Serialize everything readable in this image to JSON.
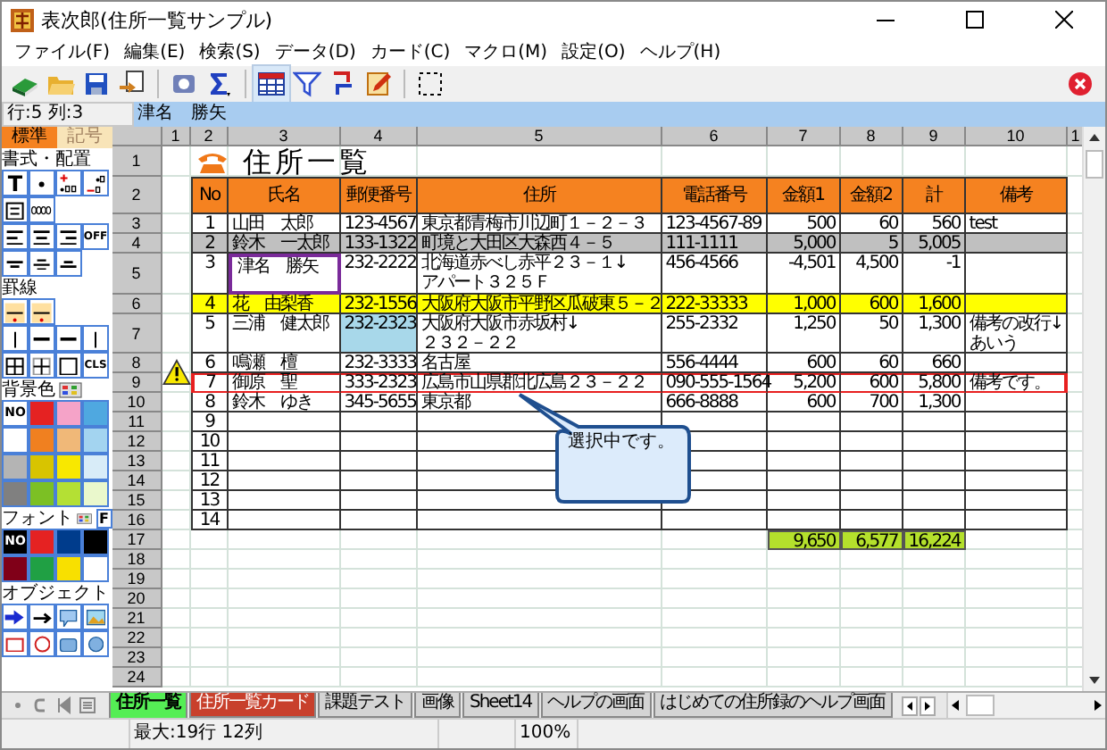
{
  "window": {
    "title": "表次郎(住所一覧サンプル)"
  },
  "menu": [
    "ファイル(F)",
    "編集(E)",
    "検索(S)",
    "データ(D)",
    "カード(C)",
    "マクロ(M)",
    "設定(O)",
    "ヘルプ(H)"
  ],
  "formula_bar": {
    "position": "行:5 列:3",
    "value": "津名　勝矢"
  },
  "palette": {
    "tabs": [
      {
        "label": "標準",
        "selected": true
      },
      {
        "label": "記号",
        "selected": false
      }
    ],
    "sections": [
      {
        "kind": "format",
        "title": "書式・配置",
        "labels": [
          "T",
          "OFF"
        ]
      },
      {
        "kind": "border",
        "title": "罫線",
        "labels": [
          "CLS"
        ]
      },
      {
        "kind": "background",
        "title": "背景色",
        "swatches": [
          {
            "label": "NO",
            "color": "#ffffff"
          },
          {
            "color": "#e52222"
          },
          {
            "color": "#f5a3c8"
          },
          {
            "color": "#4fa8e0"
          },
          {
            "color": "#ffffff"
          },
          {
            "color": "#f08020"
          },
          {
            "color": "#f0b878"
          },
          {
            "color": "#a3d4f0"
          },
          {
            "color": "#b4b4b4"
          },
          {
            "color": "#d8c400"
          },
          {
            "color": "#f8e800"
          },
          {
            "color": "#d8ecf8"
          },
          {
            "color": "#808080"
          },
          {
            "color": "#7cc024"
          },
          {
            "color": "#b4e034"
          },
          {
            "color": "#eaf8cc"
          }
        ]
      },
      {
        "kind": "font",
        "title": "フォント",
        "labels": [
          "F"
        ],
        "swatches": [
          {
            "label": "NO",
            "color": "#000000"
          },
          {
            "color": "#e52222"
          },
          {
            "color": "#003c8c"
          },
          {
            "color": "#000000"
          },
          {
            "color": "#800018"
          },
          {
            "color": "#20a044"
          },
          {
            "color": "#f8e000"
          },
          {
            "color": "#ffffff"
          }
        ]
      },
      {
        "kind": "object",
        "title": "オブジェクト"
      }
    ]
  },
  "sheet": {
    "column_headers": [
      "1",
      "2",
      "3",
      "4",
      "5",
      "6",
      "7",
      "8",
      "9",
      "10",
      "1"
    ],
    "row_headers": [
      "1",
      "2",
      "3",
      "4",
      "5",
      "6",
      "7",
      "8",
      "9",
      "10",
      "11",
      "12",
      "13",
      "14",
      "15",
      "16",
      "17",
      "18",
      "19",
      "20",
      "21",
      "22",
      "23",
      "24"
    ],
    "title": "住所一覧",
    "table": {
      "columns": [
        "No",
        "氏名",
        "郵便番号",
        "住所",
        "電話番号",
        "金額1",
        "金額2",
        "計",
        "備考"
      ],
      "rows": [
        {
          "outlined": false,
          "cells": [
            "1",
            "山田　太郎",
            "123-4567",
            "東京都青梅市川辺町１－２－３",
            "123-4567-89",
            "500",
            "60",
            "560",
            "test"
          ]
        },
        {
          "outlined": false,
          "color": "#c0c0c0",
          "cells": [
            "2",
            "鈴木　一太郎",
            "133-1322",
            "町境と大田区大森西４－５",
            "111-1111",
            "5,000",
            "5",
            "5,005",
            ""
          ]
        },
        {
          "outlined": false,
          "cells": [
            "3",
            {
              "text": "津名　勝矢",
              "selected": true
            },
            "232-2222",
            "北海道赤べし赤平２３－１↓\nアパート３２５Ｆ",
            "456-4566",
            "-4,501",
            "4,500",
            "-1",
            ""
          ]
        },
        {
          "outlined": false,
          "color": "#ffff00",
          "cells": [
            "4",
            "花　由梨香",
            "232-1556",
            "大阪府大阪市平野区瓜破東５－２",
            "222-33333",
            "1,000",
            "600",
            "1,600",
            ""
          ]
        },
        {
          "outlined": false,
          "cells": [
            "5",
            "三浦　健太郎",
            {
              "text": "232-2323",
              "color": "#a8d8ea"
            },
            "大阪府大阪市赤坂村↓\n２３２－２２",
            "255-2332",
            "1,250",
            "50",
            "1,300",
            "備考の改行↓\nあいう"
          ]
        },
        {
          "outlined": false,
          "cells": [
            "6",
            "鳴瀬　檀",
            "232-3333",
            "名古屋",
            "556-4444",
            "600",
            "60",
            "660",
            ""
          ]
        },
        {
          "outlined": true,
          "cells": [
            "7",
            "御原　聖",
            "333-2323",
            "広島市山県郡北広島２３－２２",
            "090-555-1564",
            "5,200",
            "600",
            "5,800",
            "備考です。"
          ]
        },
        {
          "outlined": false,
          "cells": [
            "8",
            "鈴木　ゆき",
            "345-5655",
            "東京都",
            "666-8888",
            "600",
            "700",
            "1,300",
            ""
          ]
        },
        {
          "outlined": false,
          "cells": [
            "9"
          ]
        },
        {
          "outlined": false,
          "cells": [
            "10"
          ]
        },
        {
          "outlined": false,
          "cells": [
            "11"
          ]
        },
        {
          "outlined": false,
          "cells": [
            "12"
          ]
        },
        {
          "outlined": false,
          "cells": [
            "13"
          ]
        },
        {
          "outlined": false,
          "cells": [
            "14"
          ]
        }
      ]
    },
    "totals": [
      "9,650",
      "6,577",
      "16,224"
    ],
    "callout": "選択中です。"
  },
  "sheet_tabs": [
    {
      "label": "住所一覧",
      "color": "#55ee55",
      "selected": true
    },
    {
      "label": "住所一覧カード",
      "color": "#c8402c",
      "selected": false
    },
    {
      "label": "課題テスト",
      "color": "#d4d4d4",
      "selected": false
    },
    {
      "label": "画像",
      "color": "#d4d4d4",
      "selected": false
    },
    {
      "label": "Sheet14",
      "color": "#d4d4d4",
      "selected": false
    },
    {
      "label": "ヘルプの画面",
      "color": "#d4d4d4",
      "selected": false
    },
    {
      "label": "はじめての住所録のヘルプ画面",
      "color": "#d4d4d4",
      "selected": false
    }
  ],
  "status_bar": {
    "size": "最大:19行 12列",
    "zoom": "100%"
  }
}
